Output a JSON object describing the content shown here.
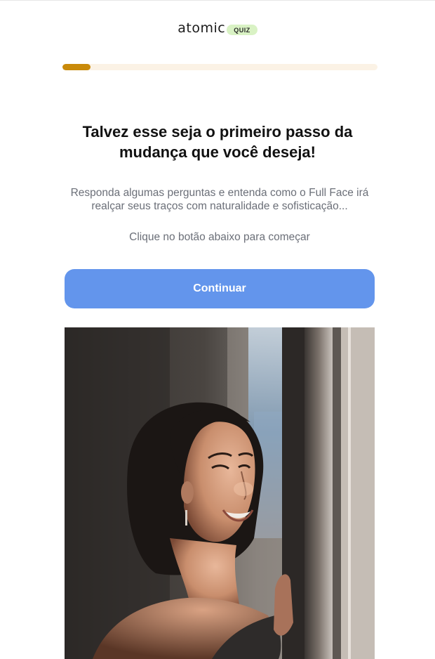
{
  "brand": {
    "wordmark": "atomic",
    "badge": "QUIZ"
  },
  "progress": {
    "value_percent": 9
  },
  "headline": "Talvez esse seja o primeiro passo da mudança que você deseja!",
  "subtext": "Responda algumas perguntas e entenda como o Full Face irá realçar seus traços com naturalidade e sofisticação...",
  "hint": "Clique no botão abaixo para começar",
  "cta": {
    "label": "Continuar"
  },
  "hero_image": {
    "alt": ""
  },
  "colors": {
    "progress_fill": "#c98a0a",
    "progress_track": "#fbf2e5",
    "button": "#6395ec",
    "badge": "#d9f2c4"
  }
}
